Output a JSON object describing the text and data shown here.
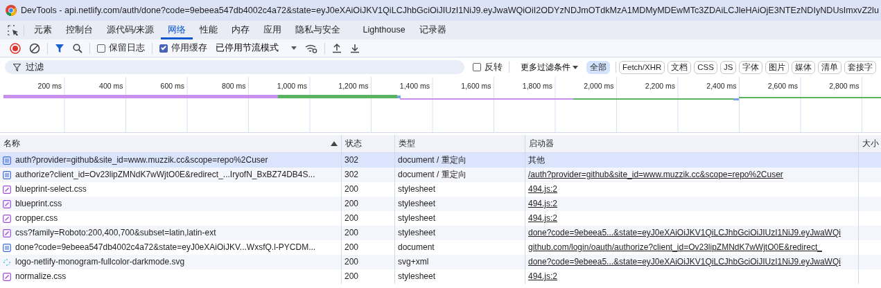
{
  "window": {
    "title": "DevTools - api.netlify.com/auth/done?code=9ebeea547db4002c4a72&state=eyJ0eXAiOiJKV1QiLCJhbGciOiJIUzI1NiJ9.eyJwaWQiOiI2ODYzNDJmOTdkMzA1MDMyMDEwMTc3ZDAiLCJleHAiOjE3NTEzNDIyNDUsImxvZ2lu"
  },
  "tabs": [
    {
      "label": "元素",
      "selected": false
    },
    {
      "label": "控制台",
      "selected": false
    },
    {
      "label": "源代码/来源",
      "selected": false
    },
    {
      "label": "网络",
      "selected": true
    },
    {
      "label": "性能",
      "selected": false
    },
    {
      "label": "内存",
      "selected": false
    },
    {
      "label": "应用",
      "selected": false
    },
    {
      "label": "隐私与安全",
      "selected": false
    },
    {
      "label": "Lighthouse",
      "selected": false
    },
    {
      "label": "记录器",
      "selected": false
    }
  ],
  "toolbar": {
    "recording": true,
    "preserve_log": {
      "label": "保留日志",
      "checked": false
    },
    "disable_cache": {
      "label": "停用缓存",
      "checked": true
    },
    "throttling": "已停用节流模式"
  },
  "filter": {
    "placeholder": "过滤",
    "invert": {
      "label": "反转",
      "checked": false
    },
    "more_filters": "更多过滤条件",
    "types": [
      {
        "label": "全部",
        "selected": true
      },
      {
        "label": "Fetch/XHR",
        "selected": false
      },
      {
        "label": "文档",
        "selected": false
      },
      {
        "label": "CSS",
        "selected": false
      },
      {
        "label": "JS",
        "selected": false
      },
      {
        "label": "字体",
        "selected": false
      },
      {
        "label": "图片",
        "selected": false
      },
      {
        "label": "媒体",
        "selected": false
      },
      {
        "label": "清单",
        "selected": false
      },
      {
        "label": "套接字",
        "selected": false
      }
    ]
  },
  "timeline": {
    "ticks": [
      "200 ms",
      "400 ms",
      "600 ms",
      "800 ms",
      "1,000 ms",
      "1,200 ms",
      "1,400 ms",
      "1,600 ms",
      "1,800 ms",
      "2,000 ms",
      "2,200 ms",
      "2,400 ms",
      "2,600 ms",
      "2,800 ms"
    ]
  },
  "table": {
    "columns": [
      "名称",
      "状态",
      "类型",
      "启动器",
      "大小"
    ],
    "rows": [
      {
        "kind": "document",
        "name": "auth?provider=github&site_id=www.muzzik.cc&scope=repo%2Cuser",
        "status": "302",
        "type": "document / 重定向",
        "initiator": "其他",
        "initiator_link": false,
        "selected": true
      },
      {
        "kind": "document",
        "name": "authorize?client_id=Ov23lipZMNdK7wWjtO0E&redirect_...IryofN_BxBZ74DB4S...",
        "status": "302",
        "type": "document / 重定向",
        "initiator": "/auth?provider=github&site_id=www.muzzik.cc&scope=repo%2Cuser",
        "initiator_link": true,
        "selected": false
      },
      {
        "kind": "stylesheet",
        "name": "blueprint-select.css",
        "status": "200",
        "type": "stylesheet",
        "initiator": "494.js:2",
        "initiator_link": true,
        "selected": false
      },
      {
        "kind": "stylesheet",
        "name": "blueprint.css",
        "status": "200",
        "type": "stylesheet",
        "initiator": "494.js:2",
        "initiator_link": true,
        "selected": false
      },
      {
        "kind": "stylesheet",
        "name": "cropper.css",
        "status": "200",
        "type": "stylesheet",
        "initiator": "494.js:2",
        "initiator_link": true,
        "selected": false
      },
      {
        "kind": "stylesheet",
        "name": "css?family=Roboto:200,400,700&subset=latin,latin-ext",
        "status": "200",
        "type": "stylesheet",
        "initiator": "done?code=9ebeea5...&state=eyJ0eXAiOiJKV1QiLCJhbGciOiJIUzI1NiJ9.eyJwaWQi",
        "initiator_link": true,
        "selected": false
      },
      {
        "kind": "document",
        "name": "done?code=9ebeea547db4002c4a72&state=eyJ0eXAiOiJKV...WxsfQ.l-PYCDM...",
        "status": "200",
        "type": "document",
        "initiator": "github.com/login/oauth/authorize?client_id=Ov23lipZMNdK7wWjtO0E&redirect_",
        "initiator_link": true,
        "selected": false
      },
      {
        "kind": "image",
        "name": "logo-netlify-monogram-fullcolor-darkmode.svg",
        "status": "200",
        "type": "svg+xml",
        "initiator": "done?code=9ebeea5...&state=eyJ0eXAiOiJKV1QiLCJhbGciOiJIUzI1NiJ9.eyJwaWQi",
        "initiator_link": true,
        "selected": false
      },
      {
        "kind": "stylesheet",
        "name": "normalize.css",
        "status": "200",
        "type": "stylesheet",
        "initiator": "494.js:2",
        "initiator_link": true,
        "selected": false
      }
    ]
  }
}
